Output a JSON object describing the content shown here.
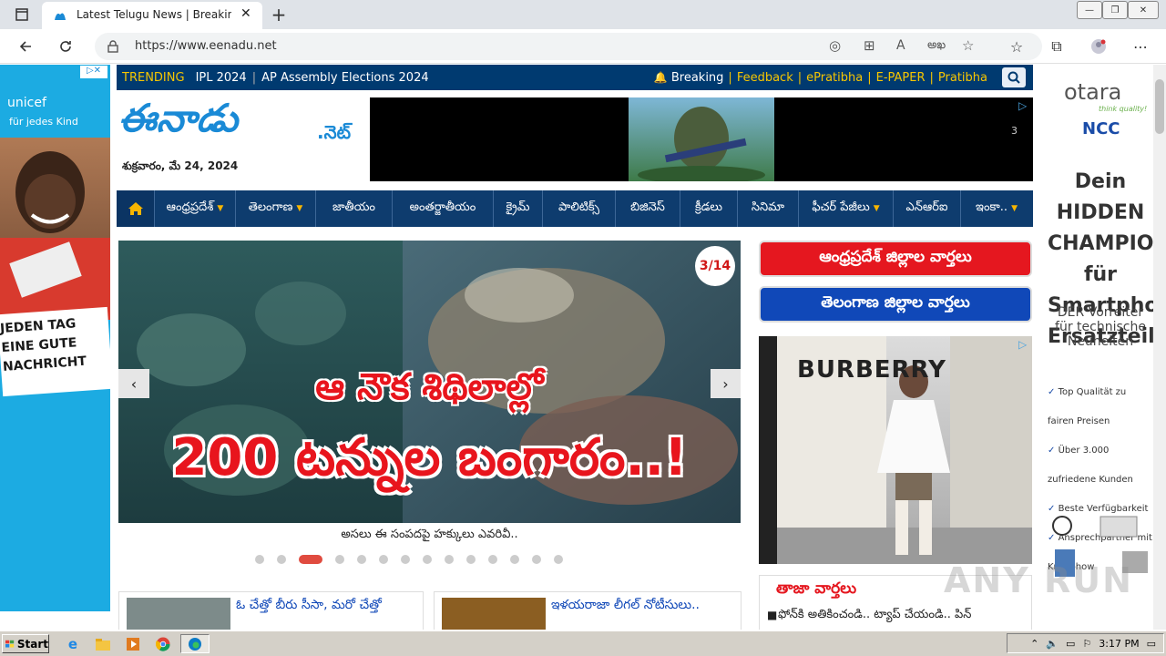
{
  "browser": {
    "tab_title": "Latest Telugu News | Breaking Ne",
    "url": "https://www.eenadu.net",
    "read_aloud_label": "A",
    "translate_label": "అఖ"
  },
  "site": {
    "trending": {
      "label": "TRENDING",
      "items": [
        "IPL 2024",
        "AP Assembly Elections 2024"
      ],
      "links": [
        "Breaking",
        "Feedback",
        "ePratibha",
        "E-PAPER",
        "Pratibha"
      ]
    },
    "logo_text": "ఈనాడు",
    "logo_suffix": ".నెట్",
    "date": "శుక్రవారం, మే 24, 2024",
    "nav": [
      "ఆంధ్రప్రదేశ్",
      "తెలంగాణ",
      "జాతీయం",
      "అంతర్జాతీయం",
      "క్రైమ్",
      "పాలిటిక్స్",
      "బిజినెస్",
      "క్రీడలు",
      "సినిమా",
      "ఫీచర్ పేజీలు",
      "ఎన్‌ఆర్‌ఐ",
      "ఇంకా.."
    ],
    "slider": {
      "counter": "3/14",
      "headline_line1": "ఆ నౌక శిథిలాల్లో",
      "headline_line2": "200 టన్నుల బంగారం..!",
      "caption": "అసలు ఈ సంపదపై హక్కులు ఎవరివీ..",
      "dot_count": 14,
      "active_dot": 2
    },
    "ap_button": "ఆంధ్రప్రదేశ్ జిల్లాల వార్తలు",
    "ts_button": "తెలంగాణ జిల్లాల వార్తలు",
    "news_cards": [
      {
        "title": "ఓ చేత్తో బీరు సీసా, మరో చేత్తో"
      },
      {
        "title": "ఇళయరాజా లీగల్ నోటీసులు.."
      }
    ],
    "latest": {
      "heading": "తాజా వార్తలు",
      "item": "ఫోన్‌కి అతికించండి.. ట్యాప్ చేయండి.. పిన్"
    },
    "ads": {
      "left_brand": "unicef",
      "left_sub": "für jedes Kind",
      "left_text": "JEDEN TAG EINE GUTE NACHRICHT",
      "right_brand": "otara",
      "right_tagline": "think quality!",
      "right_partner": "NCC",
      "right_headline": "Dein HIDDEN CHAMPION für Smartphone Ersatzteile",
      "right_sub": "DER Vorreiter für technische Neuheiten",
      "right_bullets": [
        "Top Qualität zu fairen Preisen",
        "Über 3.000 zufriedene Kunden",
        "Beste Verfügbarkeit",
        "Ansprechpartner mit Know-how"
      ],
      "side_brand": "BURBERRY",
      "top_ad_counter": "3"
    }
  },
  "taskbar": {
    "start_label": "Start",
    "time": "3:17 PM"
  },
  "watermark": "ANY RUN"
}
